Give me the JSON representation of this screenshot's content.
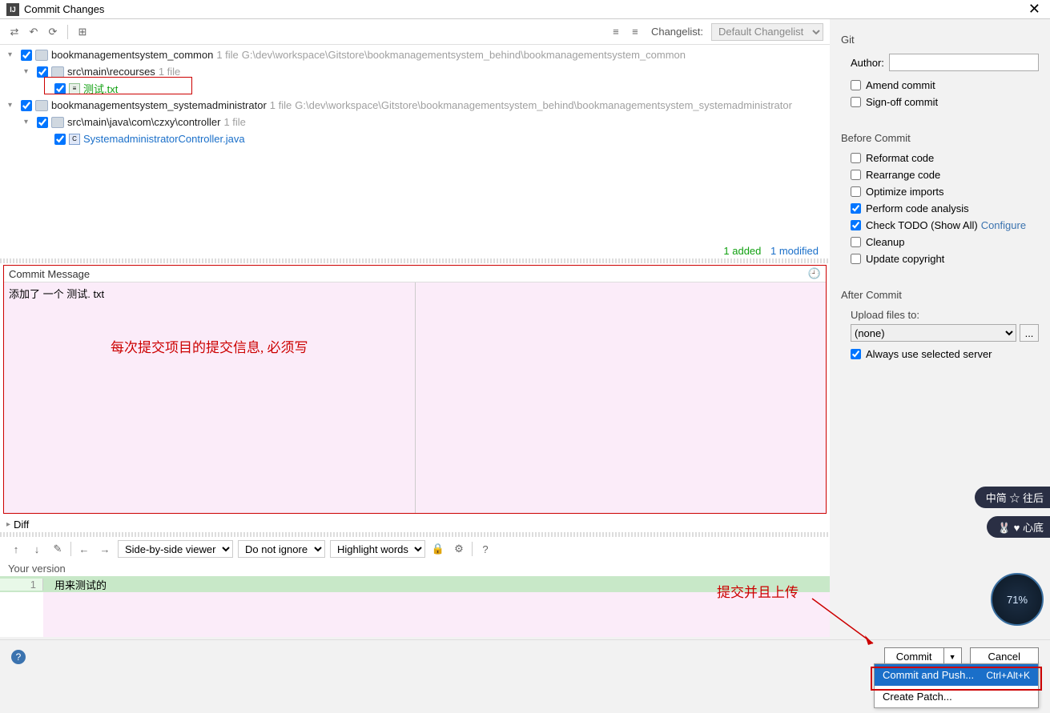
{
  "title": "Commit Changes",
  "toolbar": {
    "changelist_label": "Changelist:",
    "changelist_value": "Default Changelist"
  },
  "tree": {
    "module1": {
      "name": "bookmanagementsystem_common",
      "count": "1 file",
      "path": "G:\\dev\\workspace\\Gitstore\\bookmanagementsystem_behind\\bookmanagementsystem_common"
    },
    "folder1": {
      "name": "src\\main\\recourses",
      "count": "1 file"
    },
    "file1": {
      "name": "测试.txt"
    },
    "module2": {
      "name": "bookmanagementsystem_systemadministrator",
      "count": "1 file",
      "path": "G:\\dev\\workspace\\Gitstore\\bookmanagementsystem_behind\\bookmanagementsystem_systemadministrator"
    },
    "folder2": {
      "name": "src\\main\\java\\com\\czxy\\controller",
      "count": "1 file"
    },
    "file2": {
      "name": "SystemadministratorController.java"
    }
  },
  "status": {
    "added": "1 added",
    "modified": "1 modified"
  },
  "commit_msg": {
    "label": "Commit Message",
    "text": "添加了 一个 测试. txt",
    "annotation": "每次提交项目的提交信息, 必须写"
  },
  "diff": {
    "header": "Diff",
    "viewer": "Side-by-side viewer",
    "ignore": "Do not ignore",
    "highlight": "Highlight words",
    "your_version": "Your version",
    "line_no": "1",
    "line_text": "用来测试的"
  },
  "right": {
    "git": "Git",
    "author_label": "Author:",
    "amend": "Amend commit",
    "signoff": "Sign-off commit",
    "before": "Before Commit",
    "reformat": "Reformat code",
    "rearrange": "Rearrange code",
    "optimize": "Optimize imports",
    "analysis": "Perform code analysis",
    "todo": "Check TODO (Show All)",
    "configure": "Configure",
    "cleanup": "Cleanup",
    "copyright": "Update copyright",
    "after": "After Commit",
    "upload_label": "Upload files to:",
    "upload_value": "(none)",
    "always": "Always use selected server"
  },
  "footer": {
    "commit": "Commit",
    "cancel": "Cancel"
  },
  "menu": {
    "push": "Commit and Push...",
    "shortcut": "Ctrl+Alt+K",
    "patch": "Create Patch..."
  },
  "annotation2": "提交并且上传",
  "badge1": "中简 ☆ 往后",
  "badge2": "🐰 ♥ 心底",
  "circle": "71%"
}
